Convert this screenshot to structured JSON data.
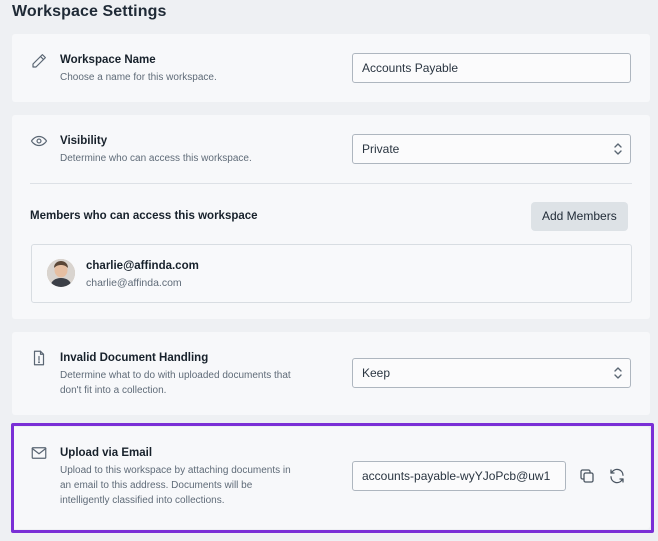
{
  "page": {
    "title": "Workspace Settings"
  },
  "workspace_name": {
    "icon": "pencil-icon",
    "title": "Workspace Name",
    "description": "Choose a name for this workspace.",
    "value": "Accounts Payable"
  },
  "visibility": {
    "icon": "eye-icon",
    "title": "Visibility",
    "description": "Determine who can access this workspace.",
    "selected": "Private"
  },
  "members": {
    "title": "Members who can access this workspace",
    "add_button": "Add Members",
    "list": [
      {
        "name": "charlie@affinda.com",
        "email": "charlie@affinda.com"
      }
    ]
  },
  "invalid_docs": {
    "icon": "file-alert-icon",
    "title": "Invalid Document Handling",
    "description_line1": "Determine what to do with uploaded documents that",
    "description_line2": "don't fit into a collection.",
    "selected": "Keep"
  },
  "upload_email": {
    "icon": "mail-icon",
    "title": "Upload via Email",
    "description_line1": "Upload to this workspace by attaching documents in",
    "description_line2": "an email to this address. Documents will be",
    "description_line3": "intelligently classified into collections.",
    "address": "accounts-payable-wyYJoPcb@uw1",
    "highlight_color": "#7a2fd6"
  }
}
